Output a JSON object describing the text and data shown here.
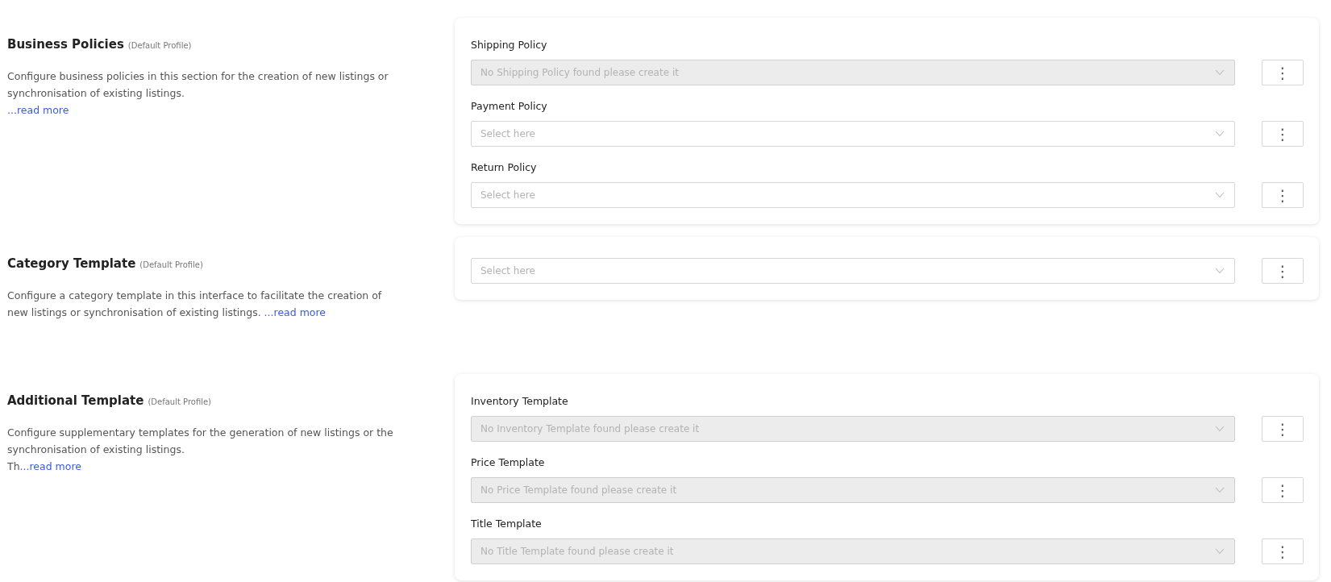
{
  "sections": [
    {
      "title": "Business Policies",
      "profile": "(Default Profile)",
      "description": "Configure business policies in this section for the creation of new listings or synchronisation of existing listings.",
      "link": "...read more",
      "link_on_new_line": true,
      "fields": [
        {
          "label": "Shipping Policy",
          "placeholder": "No Shipping Policy found please create it",
          "disabled": true,
          "menu": "⋮"
        },
        {
          "label": "Payment Policy",
          "placeholder": "Select here",
          "disabled": false,
          "menu": "⋮"
        },
        {
          "label": "Return Policy",
          "placeholder": "Select here",
          "disabled": false,
          "menu": "⋮"
        }
      ]
    },
    {
      "title": "Category Template",
      "profile": "(Default Profile)",
      "description": "Configure a category template in this interface to facilitate the creation of new listings or synchronisation of existing listings.",
      "link": "...read more",
      "link_on_new_line": false,
      "fields": [
        {
          "placeholder": "Select here",
          "disabled": false,
          "menu": "⋮"
        }
      ]
    },
    {
      "title": "Additional Template",
      "profile": "(Default Profile)",
      "description": "Configure supplementary templates for the generation of new listings or the synchronisation of existing listings.",
      "more_prefix": "Th",
      "link": "...read more",
      "link_on_new_line": true,
      "fields": [
        {
          "label": "Inventory Template",
          "placeholder": "No Inventory Template found please create it",
          "disabled": true,
          "menu": "⋮"
        },
        {
          "label": "Price Template",
          "placeholder": "No Price Template found please create it",
          "disabled": true,
          "menu": "⋮"
        },
        {
          "label": "Title Template",
          "placeholder": "No Title Template found please create it",
          "disabled": true,
          "menu": "⋮"
        }
      ]
    }
  ]
}
